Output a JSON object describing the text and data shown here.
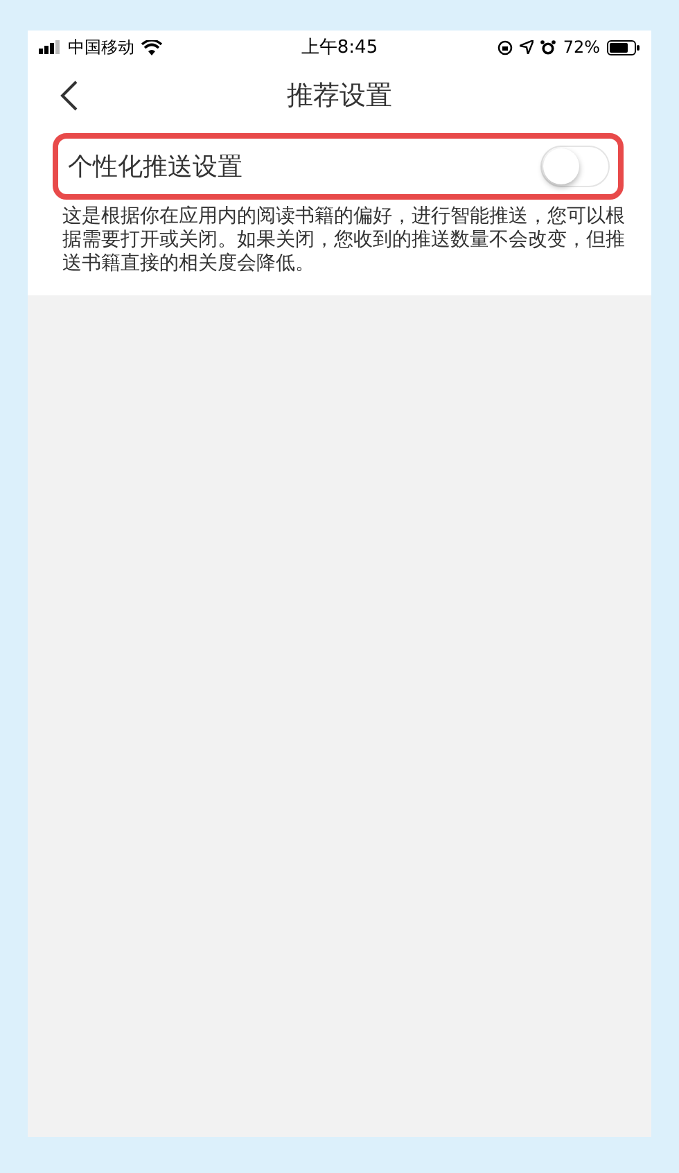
{
  "status_bar": {
    "carrier": "中国移动",
    "time": "上午8:45",
    "battery_percent": "72%"
  },
  "nav_bar": {
    "title": "推荐设置"
  },
  "setting": {
    "label": "个性化推送设置",
    "on": false,
    "highlighted": true,
    "description": "这是根据你在应用内的阅读书籍的偏好，进行智能推送，您可以根据需要打开或关闭。如果关闭，您收到的推送数量不会改变，但推送书籍直接的相关度会降低。"
  }
}
